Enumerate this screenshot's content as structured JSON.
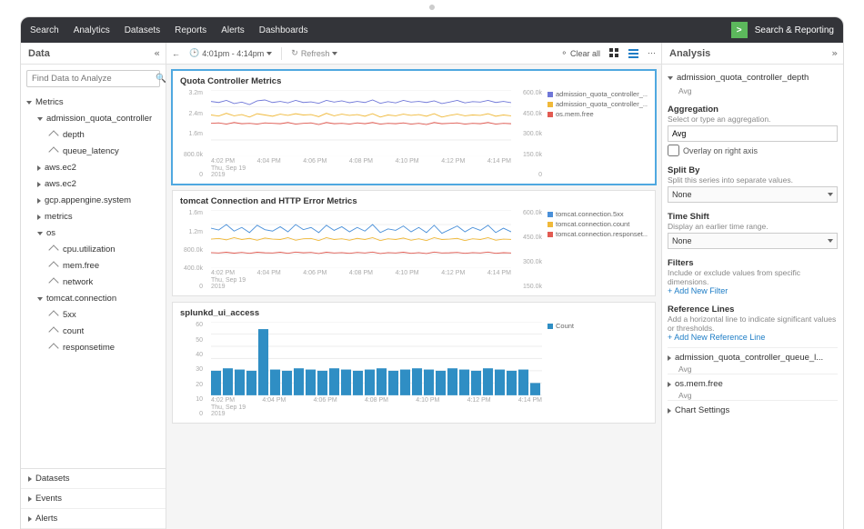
{
  "topnav": {
    "items": [
      "Search",
      "Analytics",
      "Datasets",
      "Reports",
      "Alerts",
      "Dashboards"
    ],
    "product": "Search & Reporting"
  },
  "subbar": {
    "data_label": "Data",
    "time_range": "4:01pm - 4:14pm",
    "refresh": "Refresh",
    "clear_all": "Clear all",
    "analysis_label": "Analysis"
  },
  "tree": {
    "search_placeholder": "Find Data to Analyze",
    "metrics_label": "Metrics",
    "items": [
      {
        "label": "admission_quota_controller",
        "open": true,
        "children": [
          "depth",
          "queue_latency"
        ]
      },
      {
        "label": "aws.ec2",
        "open": false
      },
      {
        "label": "aws.ec2",
        "open": false
      },
      {
        "label": "gcp.appengine.system",
        "open": false
      },
      {
        "label": "metrics",
        "open": false
      },
      {
        "label": "os",
        "open": true,
        "children": [
          "cpu.utilization",
          "mem.free",
          "network"
        ]
      },
      {
        "label": "tomcat.connection",
        "open": true,
        "children": [
          "5xx",
          "count",
          "responsetime"
        ]
      }
    ],
    "sections": [
      "Datasets",
      "Events",
      "Alerts"
    ]
  },
  "charts": {
    "x_ticks": [
      "4:02 PM",
      "4:04 PM",
      "4:06 PM",
      "4:08 PM",
      "4:10 PM",
      "4:12 PM",
      "4:14 PM"
    ],
    "x_sub": "Thu, Sep 19",
    "x_year": "2019",
    "panel1": {
      "title": "Quota Controller Metrics",
      "left_ticks": [
        "3.2m",
        "2.4m",
        "1.6m",
        "800.0k",
        "0"
      ],
      "right_ticks": [
        "600.0k",
        "450.0k",
        "300.0k",
        "150.0k",
        "0"
      ],
      "legend": [
        {
          "label": "admission_quota_controller_...",
          "color": "#6f77d8"
        },
        {
          "label": "admission_quota_controller_...",
          "color": "#f0b93a"
        },
        {
          "label": "os.mem.free",
          "color": "#e25b52"
        }
      ]
    },
    "panel2": {
      "title": "tomcat Connection and HTTP Error Metrics",
      "left_ticks": [
        "1.6m",
        "1.2m",
        "800.0k",
        "400.0k",
        "0"
      ],
      "right_ticks": [
        "600.0k",
        "450.0k",
        "300.0k",
        "150.0k"
      ],
      "legend": [
        {
          "label": "tomcat.connection.5xx",
          "color": "#4a90d9"
        },
        {
          "label": "tomcat.connection.count",
          "color": "#f0b93a"
        },
        {
          "label": "tomcat.connection.responset...",
          "color": "#e25b52"
        }
      ]
    },
    "panel3": {
      "title": "splunkd_ui_access",
      "left_ticks": [
        "60",
        "50",
        "40",
        "30",
        "20",
        "10",
        "0"
      ],
      "legend": [
        {
          "label": "Count",
          "color": "#2f8ec4"
        }
      ]
    }
  },
  "analysis": {
    "head_item": "admission_quota_controller_depth",
    "head_sub": "Avg",
    "aggregation": {
      "title": "Aggregation",
      "sub": "Select or type an aggregation.",
      "value": "Avg",
      "overlay": "Overlay on right axis"
    },
    "splitby": {
      "title": "Split By",
      "sub": "Split this series into separate values.",
      "value": "None"
    },
    "timeshift": {
      "title": "Time Shift",
      "sub": "Display an earlier time range.",
      "value": "None"
    },
    "filters": {
      "title": "Filters",
      "sub": "Include or exclude values from specific dimensions.",
      "link": "+ Add New Filter"
    },
    "reflines": {
      "title": "Reference Lines",
      "sub": "Add a horizontal line to indicate significant values or thresholds.",
      "link": "+ Add New Reference Line"
    },
    "collapsers": [
      {
        "label": "admission_quota_controller_queue_l...",
        "sub": "Avg"
      },
      {
        "label": "os.mem.free",
        "sub": "Avg"
      },
      {
        "label": "Chart Settings"
      }
    ]
  },
  "chart_data": [
    {
      "type": "line",
      "title": "Quota Controller Metrics",
      "x_ticks": [
        "4:02 PM",
        "4:04 PM",
        "4:06 PM",
        "4:08 PM",
        "4:10 PM",
        "4:12 PM",
        "4:14 PM"
      ],
      "left_axis": {
        "min": 0,
        "max": 3200000,
        "ticks": [
          0,
          800000,
          1600000,
          2400000,
          3200000
        ]
      },
      "right_axis": {
        "min": 0,
        "max": 600000,
        "ticks": [
          0,
          150000,
          300000,
          450000,
          600000
        ]
      },
      "note": "approximate values read from chart; each series ~40 samples across 4:01–4:14",
      "series": [
        {
          "name": "admission_quota_controller_...",
          "axis": "left",
          "color": "#6f77d8",
          "y": [
            2650000,
            2600000,
            2700000,
            2550000,
            2620000,
            2500000,
            2680000,
            2720000,
            2600000,
            2650000,
            2580000,
            2700000,
            2600000,
            2630000,
            2560000,
            2700000,
            2620000,
            2680000,
            2590000,
            2650000,
            2600000,
            2720000,
            2560000,
            2640000,
            2580000,
            2700000,
            2620000,
            2650000,
            2600000,
            2680000,
            2550000,
            2620000,
            2700000,
            2580000,
            2640000,
            2620000,
            2700000,
            2600000,
            2650000,
            2590000
          ]
        },
        {
          "name": "admission_quota_controller_...",
          "axis": "left",
          "color": "#f0b93a",
          "y": [
            2000000,
            1950000,
            2080000,
            1960000,
            2020000,
            1900000,
            2060000,
            2000000,
            1940000,
            2040000,
            1980000,
            2060000,
            2000000,
            2020000,
            1920000,
            2080000,
            1960000,
            2040000,
            1980000,
            2020000,
            1940000,
            2060000,
            1900000,
            2000000,
            1960000,
            2040000,
            1980000,
            2020000,
            1940000,
            2060000,
            1900000,
            1980000,
            2040000,
            1960000,
            2000000,
            1980000,
            2060000,
            1940000,
            2000000,
            1960000
          ]
        },
        {
          "name": "os.mem.free",
          "axis": "left",
          "color": "#e25b52",
          "y": [
            1600000,
            1620000,
            1560000,
            1640000,
            1580000,
            1600000,
            1560000,
            1620000,
            1600000,
            1580000,
            1640000,
            1560000,
            1600000,
            1620000,
            1540000,
            1640000,
            1580000,
            1600000,
            1560000,
            1620000,
            1580000,
            1640000,
            1560000,
            1600000,
            1580000,
            1620000,
            1560000,
            1600000,
            1540000,
            1640000,
            1580000,
            1600000,
            1620000,
            1560000,
            1600000,
            1580000,
            1640000,
            1560000,
            1600000,
            1580000
          ]
        }
      ]
    },
    {
      "type": "line",
      "title": "tomcat Connection and HTTP Error Metrics",
      "x_ticks": [
        "4:02 PM",
        "4:04 PM",
        "4:06 PM",
        "4:08 PM",
        "4:10 PM",
        "4:12 PM",
        "4:14 PM"
      ],
      "left_axis": {
        "min": 0,
        "max": 1600000,
        "ticks": [
          0,
          400000,
          800000,
          1200000,
          1600000
        ]
      },
      "right_axis": {
        "ticks": [
          150000,
          300000,
          450000,
          600000
        ]
      },
      "series": [
        {
          "name": "tomcat.connection.5xx",
          "axis": "left",
          "color": "#4a90d9",
          "y": [
            1100000,
            1050000,
            1200000,
            1020000,
            1120000,
            980000,
            1180000,
            1060000,
            1020000,
            1140000,
            1000000,
            1200000,
            1060000,
            1120000,
            980000,
            1180000,
            1040000,
            1140000,
            1000000,
            1120000,
            1020000,
            1200000,
            980000,
            1080000,
            1040000,
            1160000,
            1000000,
            1120000,
            980000,
            1180000,
            960000,
            1060000,
            1160000,
            1000000,
            1120000,
            1040000,
            1180000,
            980000,
            1100000,
            1000000
          ]
        },
        {
          "name": "tomcat.connection.count",
          "axis": "left",
          "color": "#f0b93a",
          "y": [
            800000,
            820000,
            780000,
            840000,
            790000,
            820000,
            770000,
            830000,
            800000,
            790000,
            840000,
            770000,
            810000,
            820000,
            760000,
            840000,
            790000,
            810000,
            770000,
            820000,
            790000,
            840000,
            760000,
            810000,
            790000,
            830000,
            770000,
            810000,
            760000,
            840000,
            790000,
            800000,
            820000,
            760000,
            810000,
            790000,
            840000,
            770000,
            800000,
            790000
          ]
        },
        {
          "name": "tomcat.connection.responsetime",
          "axis": "left",
          "color": "#e25b52",
          "y": [
            430000,
            420000,
            440000,
            415000,
            435000,
            410000,
            440000,
            425000,
            420000,
            440000,
            410000,
            445000,
            425000,
            435000,
            405000,
            440000,
            420000,
            430000,
            410000,
            435000,
            420000,
            445000,
            405000,
            430000,
            420000,
            440000,
            410000,
            430000,
            405000,
            445000,
            420000,
            425000,
            435000,
            410000,
            430000,
            420000,
            445000,
            410000,
            428000,
            420000
          ]
        }
      ]
    },
    {
      "type": "bar",
      "title": "splunkd_ui_access",
      "x_ticks": [
        "4:02 PM",
        "4:04 PM",
        "4:06 PM",
        "4:08 PM",
        "4:10 PM",
        "4:12 PM",
        "4:14 PM"
      ],
      "ylim": [
        0,
        60
      ],
      "categories_note": "28 bars across 4:01–4:14, ~30s bins",
      "series": [
        {
          "name": "Count",
          "color": "#2f8ec4",
          "y": [
            20,
            22,
            21,
            20,
            54,
            21,
            20,
            22,
            21,
            20,
            22,
            21,
            20,
            21,
            22,
            20,
            21,
            22,
            21,
            20,
            22,
            21,
            20,
            22,
            21,
            20,
            21,
            10
          ]
        }
      ]
    }
  ]
}
